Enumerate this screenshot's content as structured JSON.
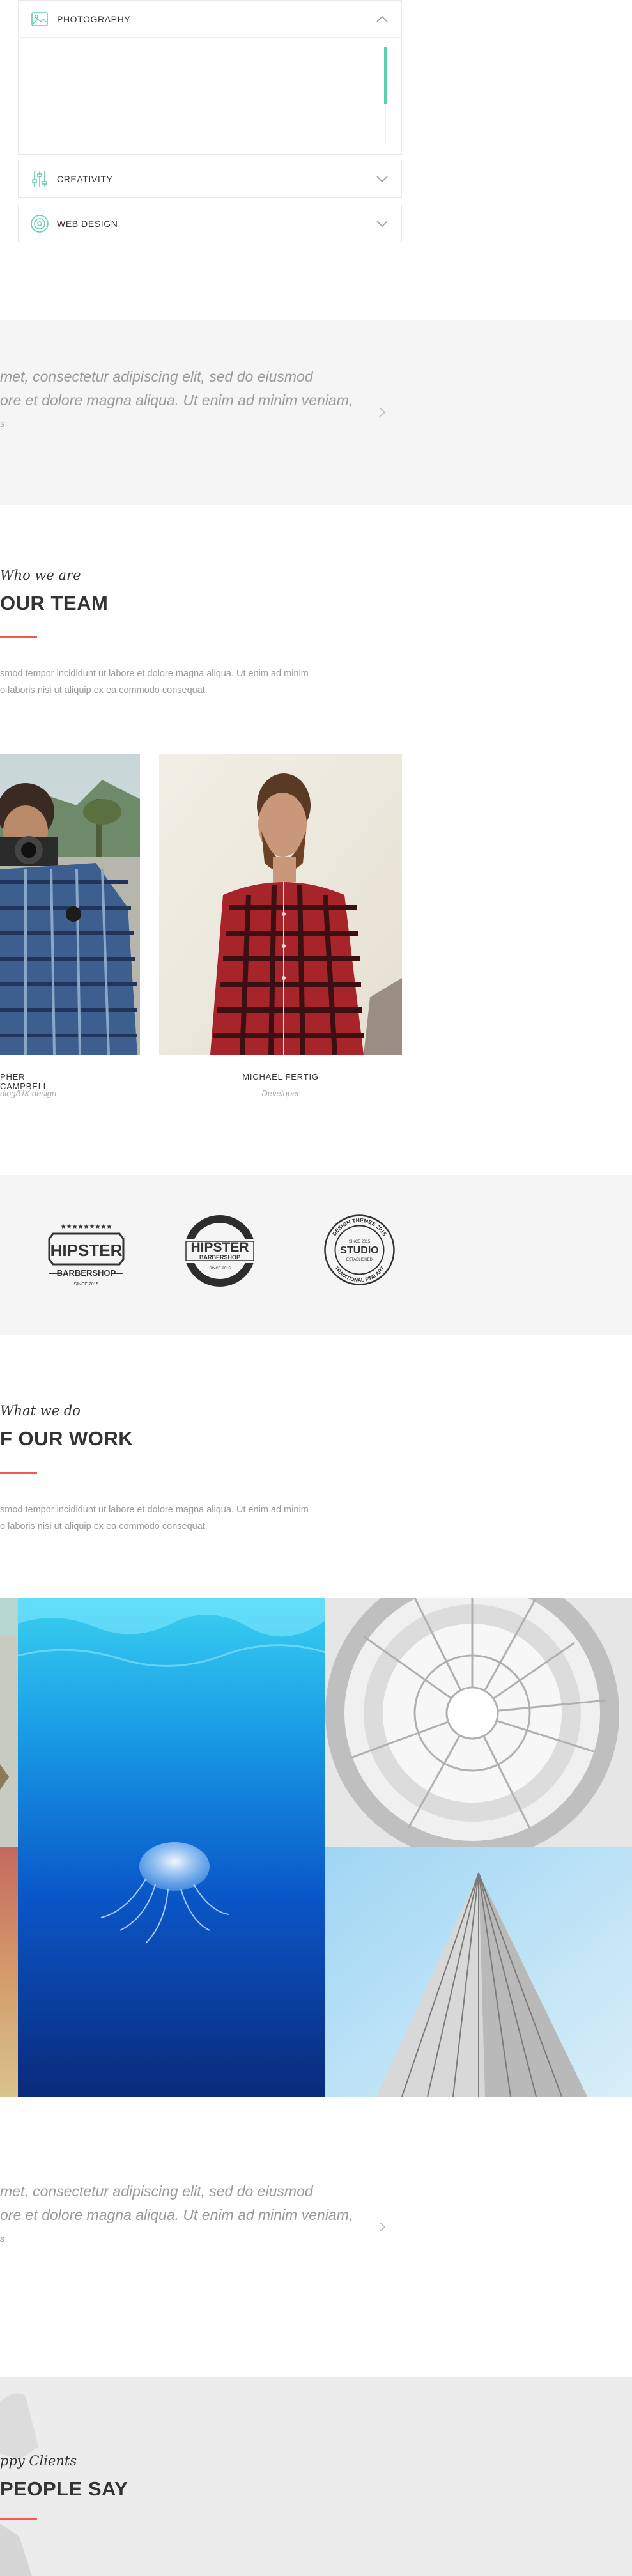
{
  "accordion": {
    "items": [
      {
        "title": "PHOTOGRAPHY",
        "icon": "image-icon",
        "expanded": true
      },
      {
        "title": "CREATIVITY",
        "icon": "sliders-icon",
        "expanded": false
      },
      {
        "title": "WEB DESIGN",
        "icon": "target-icon",
        "expanded": false
      }
    ],
    "accent": "#5fcfa7"
  },
  "testimonial_top": {
    "line1": "met, consectetur adipiscing elit, sed do eiusmod",
    "line2": "ore et dolore magna aliqua. Ut enim ad minim veniam,",
    "line3": "s"
  },
  "team": {
    "eyebrow": "Who we are",
    "heading": "OUR TEAM",
    "para_line1": "smod tempor incididunt ut labore et dolore magna aliqua. Ut enim ad minim",
    "para_line2": "o laboris nisi ut aliquip ex ea commodo consequat.",
    "members": [
      {
        "name": "PHER CAMPBELL",
        "role": "ding/UX design"
      },
      {
        "name": "MICHAEL FERTIG",
        "role": "Developer"
      }
    ]
  },
  "clients": {
    "logos": [
      {
        "top": "HIPSTER",
        "bottom": "BARBERSHOP",
        "small": "SINCE 2015"
      },
      {
        "top": "HIPSTER",
        "bottom": "BARBERSHOP",
        "small": "SINCE 2015"
      },
      {
        "ring": "DESIGN THEMES 2015",
        "top": "STUDIO",
        "bottom": "TRADITIONAL FINE ART",
        "small": "ESTABLISHED",
        "sub": "SINCE 2015"
      }
    ]
  },
  "work": {
    "eyebrow": "What we do",
    "heading": "F OUR WORK",
    "para_line1": "smod tempor incididunt ut labore et dolore magna aliqua. Ut enim ad minim",
    "para_line2": "o laboris nisi ut aliquip ex ea commodo consequat."
  },
  "testimonial_bottom": {
    "line1": "met, consectetur adipiscing elit, sed do eiusmod",
    "line2": "ore et dolore magna aliqua. Ut enim ad minim veniam,",
    "line3": "s"
  },
  "clients_say": {
    "eyebrow": "ppy Clients",
    "heading": "PEOPLE SAY"
  },
  "colors": {
    "accent_red": "#f05a4f",
    "accent_green": "#5fcfa7",
    "band": "#f5f5f5"
  }
}
